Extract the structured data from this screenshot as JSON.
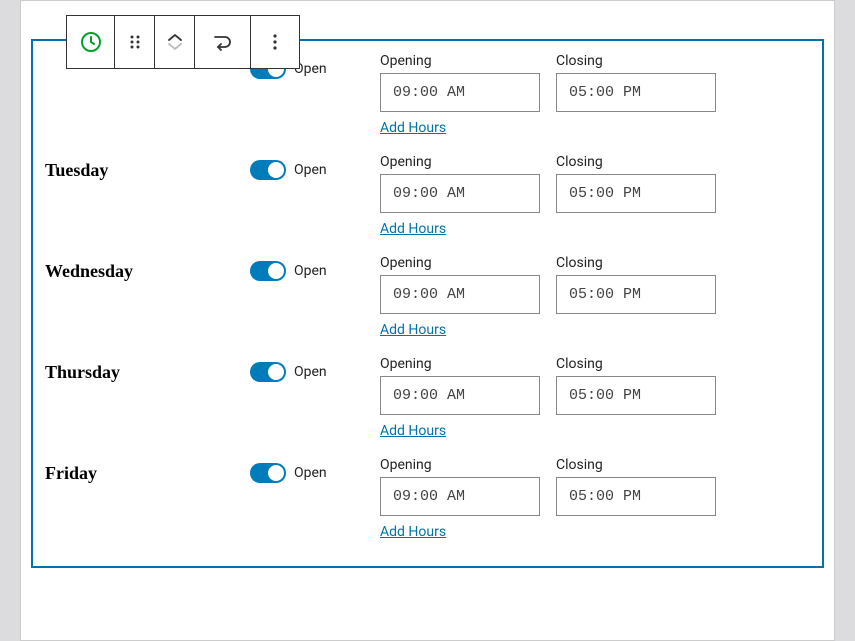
{
  "labels": {
    "opening": "Opening",
    "closing": "Closing",
    "add_hours": "Add Hours",
    "open_toggle": "Open"
  },
  "days": [
    {
      "name": "",
      "open": true,
      "opening": "09:00 AM",
      "closing": "05:00 PM"
    },
    {
      "name": "Tuesday",
      "open": true,
      "opening": "09:00 AM",
      "closing": "05:00 PM"
    },
    {
      "name": "Wednesday",
      "open": true,
      "opening": "09:00 AM",
      "closing": "05:00 PM"
    },
    {
      "name": "Thursday",
      "open": true,
      "opening": "09:00 AM",
      "closing": "05:00 PM"
    },
    {
      "name": "Friday",
      "open": true,
      "opening": "09:00 AM",
      "closing": "05:00 PM"
    }
  ]
}
